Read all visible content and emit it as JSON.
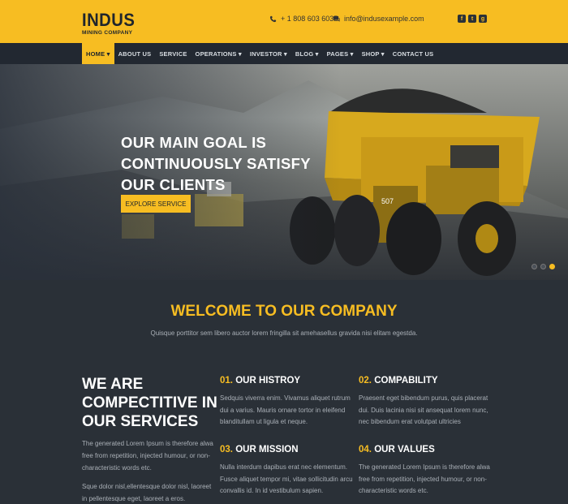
{
  "header": {
    "logo_title": "INDUS",
    "logo_subtitle": "MINING COMPANY",
    "phone": "+ 1 808 603 6035",
    "email": "info@indusexample.com",
    "social": [
      "facebook-icon",
      "twitter-icon",
      "google-plus-icon"
    ]
  },
  "nav": {
    "items": [
      {
        "label": "HOME ▾"
      },
      {
        "label": "ABOUT US"
      },
      {
        "label": "SERVICE"
      },
      {
        "label": "OPERATIONS ▾"
      },
      {
        "label": "INVESTOR ▾"
      },
      {
        "label": "BLOG ▾"
      },
      {
        "label": "PAGES ▾"
      },
      {
        "label": "SHOP ▾"
      },
      {
        "label": "CONTACT US"
      }
    ]
  },
  "hero": {
    "heading": "OUR MAIN GOAL IS CONTINUOUSLY SATISFY OUR CLIENTS",
    "button": "EXPLORE SERVICE",
    "truck_number": "507"
  },
  "welcome": {
    "title": "WELCOME TO OUR COMPANY",
    "subtitle": "Quisque porttitor sem libero auctor lorem fringilla sit amehasellus gravida nisi elitam egestda."
  },
  "about": {
    "heading": "WE ARE COMPECTITIVE IN OUR SERVICES",
    "para1": "The generated Lorem Ipsum is therefore alwa free from repetition, injected humour, or non-characteristic words etc.",
    "para2": "Sque dolor nisl,ellentesque dolor nisl, laoreet in pellentesque eget, laoreet a eros."
  },
  "features": [
    {
      "num": "01.",
      "title": "OUR HISTROY",
      "text": "Sedquis viverra enim. Vivamus aliquet rutrum dui a varius. Mauris ornare tortor in eleifend blanditullam ut ligula et neque."
    },
    {
      "num": "02.",
      "title": "COMPABILITY",
      "text": "Praesent eget bibendum purus, quis placerat dui. Duis lacinia nisi sit ansequat lorem nunc, nec bibendum erat volutpat ultricies"
    },
    {
      "num": "03.",
      "title": "OUR MISSION",
      "text": "Nulla interdum dapibus erat nec elementum. Fusce aliquet tempor mi, vitae sollicitudin arcu convallis id. In id vestibulum sapien."
    },
    {
      "num": "04.",
      "title": "OUR VALUES",
      "text": "The generated Lorem Ipsum is therefore alwa free from repetition, injected humour, or non-characteristic words etc."
    }
  ],
  "colors": {
    "accent": "#f7bd22",
    "dark": "#2a3037",
    "nav": "#222831"
  }
}
